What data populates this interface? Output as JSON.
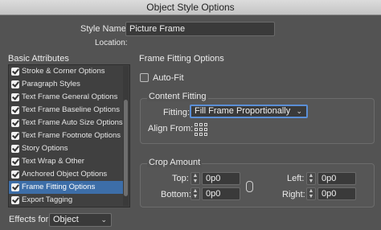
{
  "window": {
    "title": "Object Style Options"
  },
  "header": {
    "style_name_label": "Style Name:",
    "style_name_value": "Picture Frame",
    "location_label": "Location:"
  },
  "sidebar": {
    "heading": "Basic Attributes",
    "items": [
      {
        "label": "Stroke & Corner Options",
        "checked": true
      },
      {
        "label": "Paragraph Styles",
        "checked": true
      },
      {
        "label": "Text Frame General Options",
        "checked": true
      },
      {
        "label": "Text Frame Baseline Options",
        "checked": true
      },
      {
        "label": "Text Frame Auto Size Options",
        "checked": true
      },
      {
        "label": "Text Frame Footnote Options",
        "checked": true
      },
      {
        "label": "Story Options",
        "checked": true
      },
      {
        "label": "Text Wrap & Other",
        "checked": true
      },
      {
        "label": "Anchored Object Options",
        "checked": true
      },
      {
        "label": "Frame Fitting Options",
        "checked": true,
        "selected": true
      },
      {
        "label": "Export Tagging",
        "checked": true
      }
    ]
  },
  "effects": {
    "label": "Effects for:",
    "value": "Object"
  },
  "main": {
    "section_title": "Frame Fitting Options",
    "auto_fit_label": "Auto-Fit",
    "content_fitting": {
      "title": "Content Fitting",
      "fitting_label": "Fitting:",
      "fitting_value": "Fill Frame Proportionally",
      "align_from_label": "Align From:"
    },
    "crop_amount": {
      "title": "Crop Amount",
      "top_label": "Top:",
      "top_value": "0p0",
      "bottom_label": "Bottom:",
      "bottom_value": "0p0",
      "left_label": "Left:",
      "left_value": "0p0",
      "right_label": "Right:",
      "right_value": "0p0"
    }
  },
  "colors": {
    "accent": "#3d6ea8",
    "focus": "#5b8fd6",
    "panel": "#535353"
  }
}
